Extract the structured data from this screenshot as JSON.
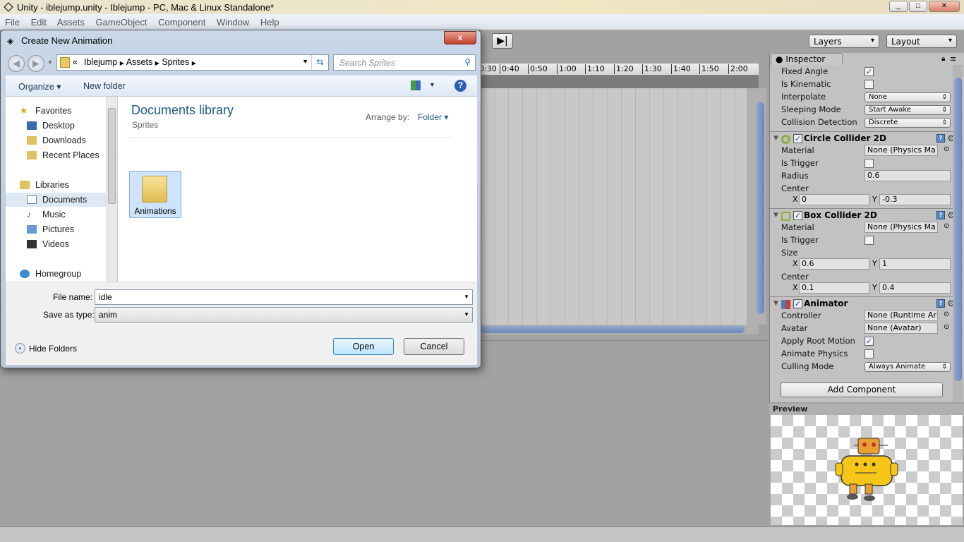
{
  "window": {
    "title": "Unity - iblejump.unity - Iblejump - PC, Mac & Linux Standalone*",
    "controls": [
      "minimize",
      "maximize",
      "close"
    ]
  },
  "menu": [
    "File",
    "Edit",
    "Assets",
    "GameObject",
    "Component",
    "Window",
    "Help"
  ],
  "toolbar": {
    "layers": "Layers",
    "layout": "Layout",
    "step_icon": "step-forward-icon"
  },
  "timeline": {
    "ticks": [
      "0:30",
      "0:40",
      "0:50",
      "1:00",
      "1:10",
      "1:20",
      "1:30",
      "1:40",
      "1:50",
      "2:00"
    ]
  },
  "inspector": {
    "tab": "Inspector",
    "rigidbody": [
      {
        "label": "Fixed Angle",
        "type": "check",
        "value": true
      },
      {
        "label": "Is Kinematic",
        "type": "check",
        "value": false
      },
      {
        "label": "Interpolate",
        "type": "select",
        "value": "None"
      },
      {
        "label": "Sleeping Mode",
        "type": "select",
        "value": "Start Awake"
      },
      {
        "label": "Collision Detection",
        "type": "select",
        "value": "Discrete"
      }
    ],
    "circle": {
      "title": "Circle Collider 2D",
      "material_label": "Material",
      "material": "None (Physics Ma",
      "trigger_label": "Is Trigger",
      "radius_label": "Radius",
      "radius": "0.6",
      "center_label": "Center",
      "x": "0",
      "y": "-0.3"
    },
    "box": {
      "title": "Box Collider 2D",
      "material_label": "Material",
      "material": "None (Physics Ma",
      "trigger_label": "Is Trigger",
      "size_label": "Size",
      "size_x": "0.6",
      "size_y": "1",
      "center_label": "Center",
      "x": "0.1",
      "y": "0.4"
    },
    "animator": {
      "title": "Animator",
      "controller_label": "Controller",
      "controller": "None (Runtime Ar",
      "avatar_label": "Avatar",
      "avatar": "None (Avatar)",
      "root_label": "Apply Root Motion",
      "root": true,
      "physics_label": "Animate Physics",
      "physics": false,
      "culling_label": "Culling Mode",
      "culling": "Always Animate"
    },
    "axis_x": "X",
    "axis_y": "Y",
    "add_component": "Add Component",
    "preview": "Preview"
  },
  "dialog": {
    "title": "Create New Animation",
    "close": "x",
    "breadcrumb": [
      "«",
      "Iblejump",
      "Assets",
      "Sprites"
    ],
    "search_placeholder": "Search Sprites",
    "organize": "Organize ▾",
    "new_folder": "New folder",
    "nav": {
      "favorites": "Favorites",
      "desktop": "Desktop",
      "downloads": "Downloads",
      "recent": "Recent Places",
      "libraries": "Libraries",
      "documents": "Documents",
      "music": "Music",
      "pictures": "Pictures",
      "videos": "Videos",
      "homegroup": "Homegroup"
    },
    "library_title": "Documents library",
    "library_sub": "Sprites",
    "arrange_label": "Arrange by:",
    "arrange_value": "Folder ▾",
    "items": [
      "Animations"
    ],
    "file_name_label": "File name:",
    "file_name": "idle",
    "type_label": "Save as type:",
    "type": "anim",
    "hide_folders": "Hide Folders",
    "open": "Open",
    "cancel": "Cancel"
  }
}
